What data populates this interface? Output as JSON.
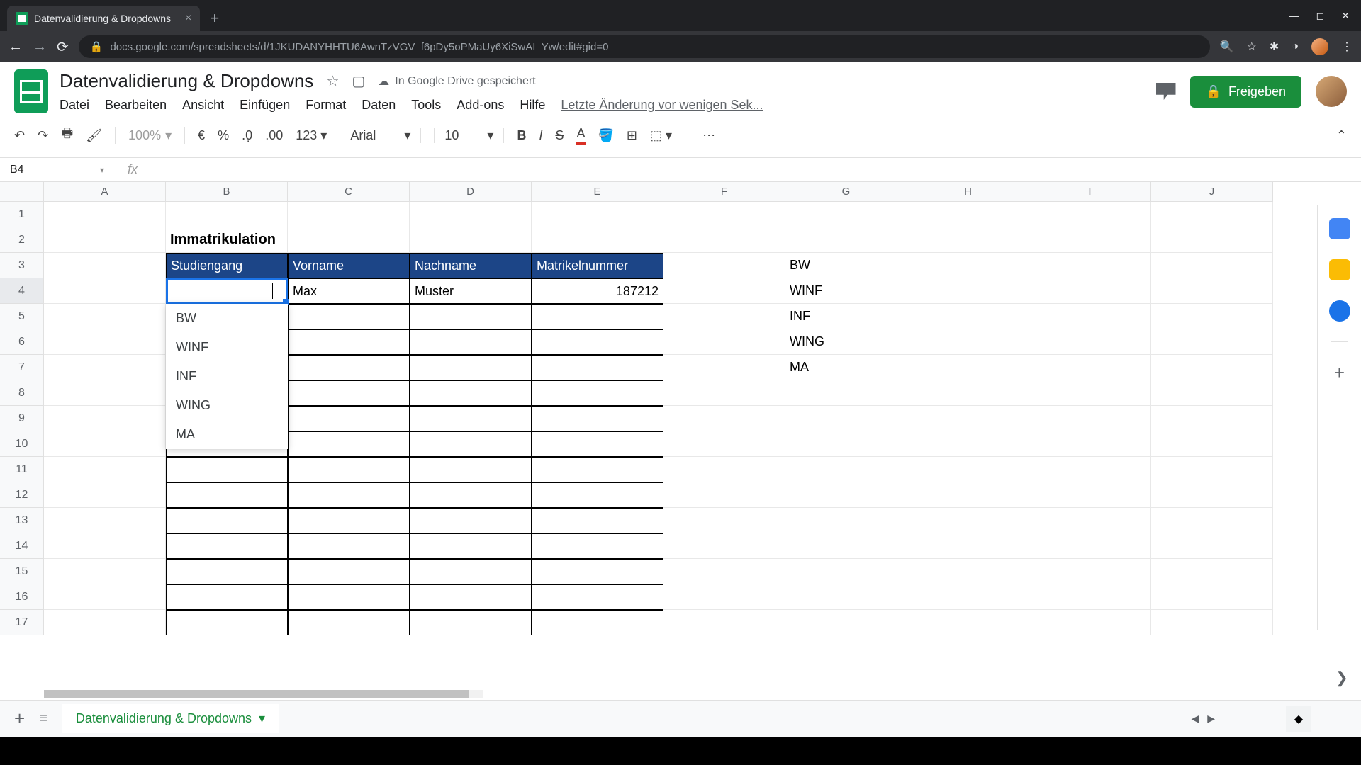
{
  "browser": {
    "tab_title": "Datenvalidierung & Dropdowns",
    "url": "docs.google.com/spreadsheets/d/1JKUDANYHHTU6AwnTzVGV_f6pDy5oPMaUy6XiSwAI_Yw/edit#gid=0"
  },
  "sheets": {
    "doc_title": "Datenvalidierung & Dropdowns",
    "cloud_status": "In Google Drive gespeichert",
    "share_label": "Freigeben",
    "menu": {
      "file": "Datei",
      "edit": "Bearbeiten",
      "view": "Ansicht",
      "insert": "Einfügen",
      "format": "Format",
      "data": "Daten",
      "tools": "Tools",
      "addons": "Add-ons",
      "help": "Hilfe",
      "history": "Letzte Änderung vor wenigen Sek..."
    },
    "toolbar": {
      "zoom": "100%",
      "format_num": "123",
      "font": "Arial",
      "font_size": "10"
    },
    "name_box": "B4",
    "columns": [
      "A",
      "B",
      "C",
      "D",
      "E",
      "F",
      "G",
      "H",
      "I",
      "J"
    ],
    "rows": [
      "1",
      "2",
      "3",
      "4",
      "5",
      "6",
      "7",
      "8",
      "9",
      "10",
      "11",
      "12",
      "13",
      "14",
      "15",
      "16",
      "17"
    ],
    "table": {
      "title": "Immatrikulation",
      "headers": [
        "Studiengang",
        "Vorname",
        "Nachname",
        "Matrikelnummer"
      ],
      "row1": {
        "vorname": "Max",
        "nachname": "Muster",
        "matrikel": "187212"
      }
    },
    "dropdown_options": [
      "BW",
      "WINF",
      "INF",
      "WING",
      "MA"
    ],
    "list_values": [
      "BW",
      "WINF",
      "INF",
      "WING",
      "MA"
    ],
    "sheet_tab": "Datenvalidierung & Dropdowns"
  }
}
